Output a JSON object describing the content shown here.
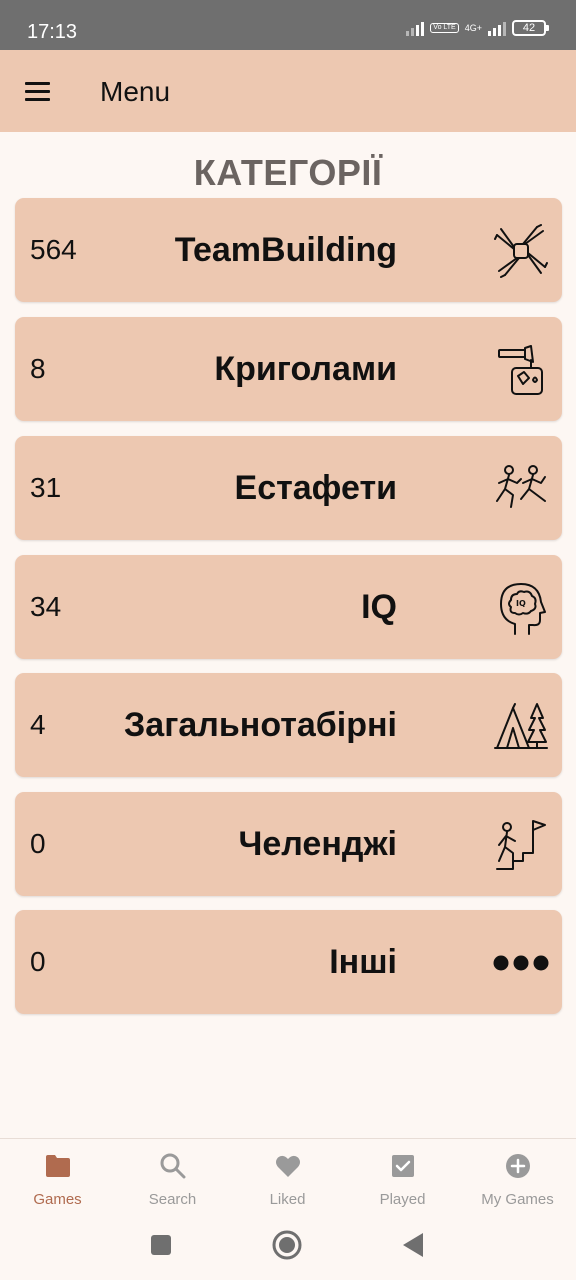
{
  "status_bar": {
    "time": "17:13",
    "volte": "Vo LTE",
    "network": "4G+",
    "battery": "42"
  },
  "app_bar": {
    "title": "Menu",
    "menu_icon": "hamburger-icon"
  },
  "section_title": "КАТЕГОРІЇ",
  "categories": [
    {
      "count": "564",
      "name": "TeamBuilding",
      "icon": "teamwork-hands-icon"
    },
    {
      "count": "8",
      "name": "Криголами",
      "icon": "ice-axe-icon"
    },
    {
      "count": "31",
      "name": "Естафети",
      "icon": "relay-runners-icon"
    },
    {
      "count": "34",
      "name": "IQ",
      "icon": "brain-head-icon"
    },
    {
      "count": "4",
      "name": "Загальнотабірні",
      "icon": "camp-tent-icon"
    },
    {
      "count": "0",
      "name": "Челенджі",
      "icon": "stairs-flag-icon"
    },
    {
      "count": "0",
      "name": "Інші",
      "icon": "more-dots-icon"
    }
  ],
  "bottom_nav": [
    {
      "label": "Games",
      "icon": "folder-icon",
      "active": true
    },
    {
      "label": "Search",
      "icon": "search-icon",
      "active": false
    },
    {
      "label": "Liked",
      "icon": "heart-icon",
      "active": false
    },
    {
      "label": "Played",
      "icon": "checkbox-icon",
      "active": false
    },
    {
      "label": "My Games",
      "icon": "plus-circle-icon",
      "active": false
    }
  ],
  "colors": {
    "card": "#edc8b1",
    "background": "#fdf7f3",
    "accent": "#b06b4f",
    "inactive": "#9a9a9a",
    "title": "#6b6461"
  }
}
